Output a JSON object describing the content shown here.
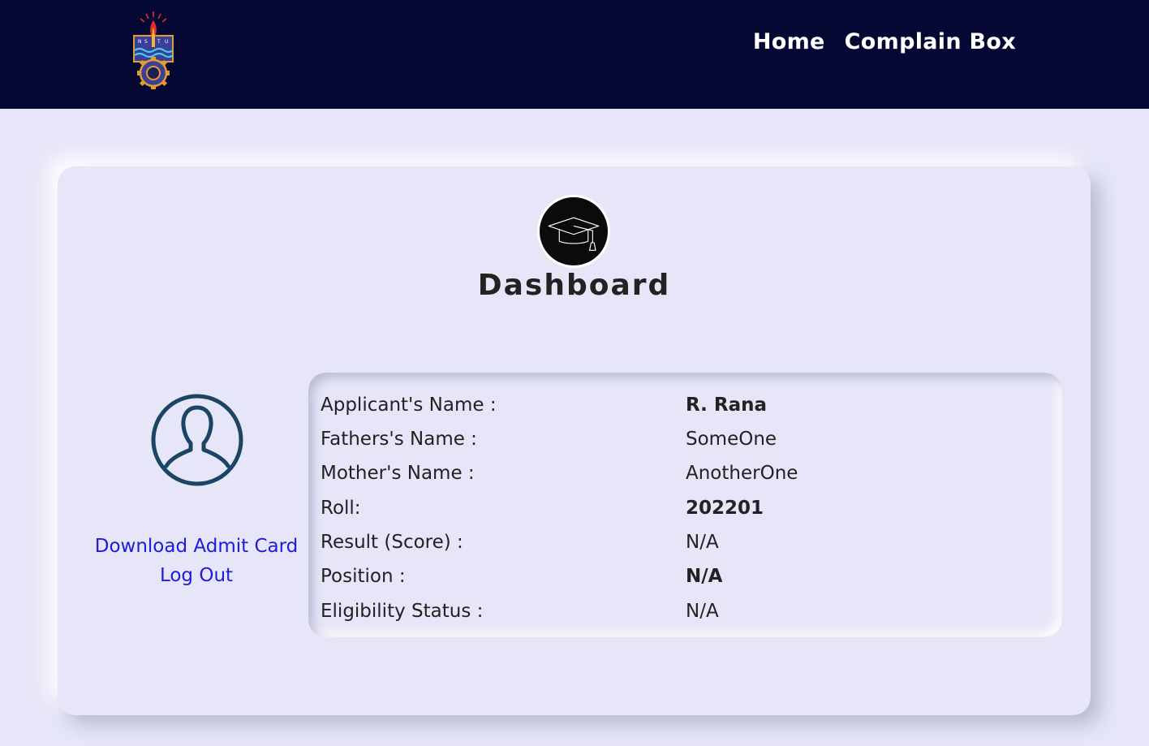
{
  "header": {
    "logo_letters": [
      "N",
      "S",
      "T",
      "U"
    ],
    "nav": [
      {
        "label": "Home"
      },
      {
        "label": "Complain Box"
      }
    ]
  },
  "dashboard": {
    "title": "Dashboard",
    "icons": {
      "badge": "graduation-cap-icon",
      "avatar": "user-avatar-icon"
    },
    "actions": {
      "download_admit_card": "Download Admit Card",
      "log_out": "Log Out"
    },
    "info": [
      {
        "label": "Applicant's Name :",
        "value": "R. Rana",
        "bold": true
      },
      {
        "label": "Fathers's Name :",
        "value": "SomeOne",
        "bold": false
      },
      {
        "label": "Mother's Name :",
        "value": "AnotherOne",
        "bold": false
      },
      {
        "label": "Roll:",
        "value": "202201",
        "bold": true
      },
      {
        "label": "Result (Score) :",
        "value": "N/A",
        "bold": false
      },
      {
        "label": "Position :",
        "value": "N/A",
        "bold": true
      },
      {
        "label": "Eligibility Status :",
        "value": "N/A",
        "bold": false
      }
    ]
  },
  "colors": {
    "header_bg": "#050833",
    "page_bg": "#e6e6f8",
    "link": "#1c1cdc",
    "avatar_stroke": "#1a4565"
  }
}
